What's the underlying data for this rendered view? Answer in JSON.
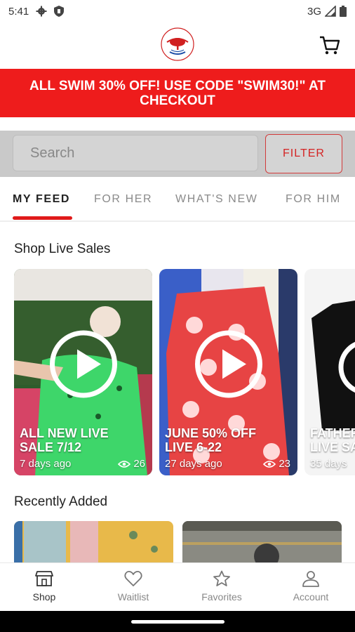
{
  "status_bar": {
    "time": "5:41",
    "network": "3G"
  },
  "header": {
    "logo_icon": "pecan-creek-outfitters-logo",
    "cart_icon": "cart-icon"
  },
  "promo": {
    "text": "ALL SWIM 30% OFF! USE CODE \"SWIM30!\" AT CHECKOUT",
    "color": "#ee1c1c"
  },
  "search": {
    "placeholder": "Search",
    "filter_label": "FILTER"
  },
  "tabs": [
    {
      "label": "MY FEED",
      "active": true
    },
    {
      "label": "FOR HER",
      "active": false
    },
    {
      "label": "WHAT'S NEW",
      "active": false
    },
    {
      "label": "FOR HIM",
      "active": false
    }
  ],
  "live_sales": {
    "title": "Shop Live Sales",
    "items": [
      {
        "title_line1": "ALL NEW LIVE",
        "title_line2": "SALE 7/12",
        "ago": "7 days ago",
        "views": "26"
      },
      {
        "title_line1": "JUNE 50% OFF",
        "title_line2": "LIVE 6-22",
        "ago": "27 days ago",
        "views": "23"
      },
      {
        "title_line1": "FATHER",
        "title_line2": "LIVE SA",
        "ago": "35 days",
        "views": ""
      }
    ]
  },
  "recently_added": {
    "title": "Recently Added"
  },
  "bottom_nav": [
    {
      "label": "Shop",
      "icon": "shop-icon",
      "active": true
    },
    {
      "label": "Waitlist",
      "icon": "heart-icon",
      "active": false
    },
    {
      "label": "Favorites",
      "icon": "star-icon",
      "active": false
    },
    {
      "label": "Account",
      "icon": "person-icon",
      "active": false
    }
  ],
  "colors": {
    "accent": "#e01a1a"
  }
}
